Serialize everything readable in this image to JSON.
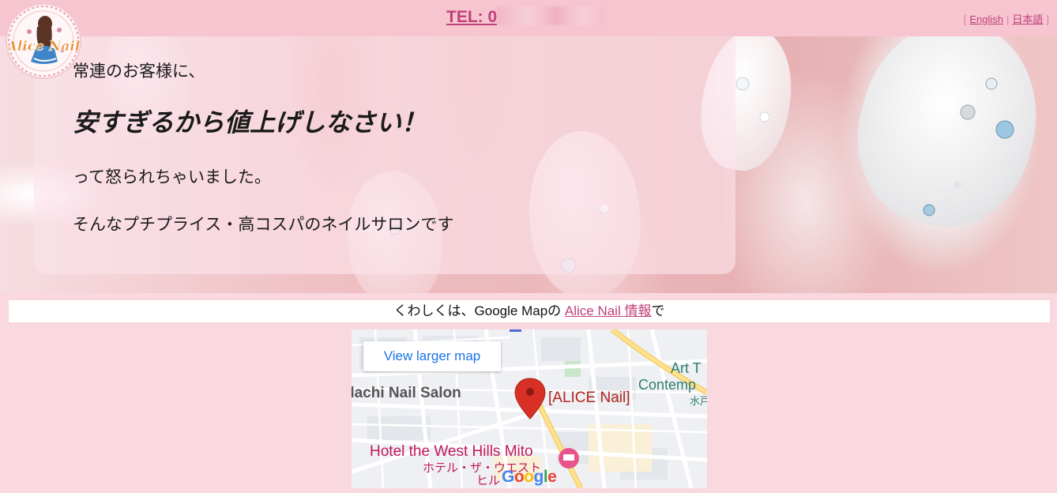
{
  "header": {
    "tel_label": "TEL: 0",
    "languages": [
      "English",
      "日本語"
    ]
  },
  "logo": {
    "text": "Alice Nail"
  },
  "hero": {
    "line1": "常連のお客様に、",
    "line2": "安すぎるから値上げしなさい！",
    "line3": "って怒られちゃいました。",
    "line4": "そんなプチプライス・高コスパのネイルサロンです"
  },
  "info": {
    "prefix": "くわしくは、Google Mapの ",
    "link_text": "Alice Nail 情報",
    "suffix": "で"
  },
  "map": {
    "view_larger": "View larger map",
    "labels": {
      "nail_salon": "dachi Nail Salon",
      "alice": "[ALICE Nail]",
      "hotel": "Hotel the West Hills Mito",
      "hotel_jp": "ホテル・ザ・ウエスト",
      "hiru": "ヒル",
      "art1": "Art T",
      "art2": "Contemp",
      "art3": "水戸"
    },
    "google_letters": [
      "G",
      "o",
      "o",
      "g",
      "l",
      "e"
    ]
  },
  "colors": {
    "accent": "#c0407a",
    "topbar": "#f6c5d0",
    "background": "#f9d8df",
    "map_link": "#1a73e8",
    "pin": "#d93025"
  }
}
